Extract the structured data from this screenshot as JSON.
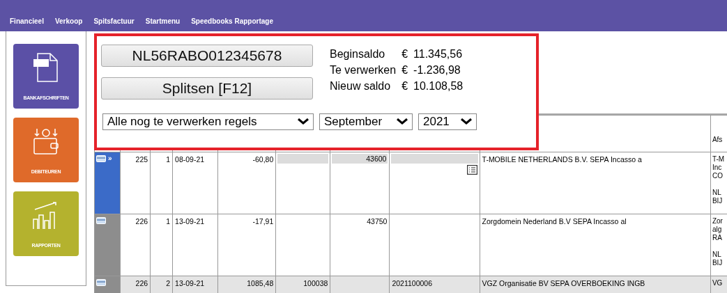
{
  "menu": [
    {
      "label": "Financieel"
    },
    {
      "label": "Verkoop"
    },
    {
      "label": "Spitsfactuur"
    },
    {
      "label": "Startmenu"
    },
    {
      "label": "Speedbooks Rapportage"
    }
  ],
  "tiles": [
    {
      "label": "BANKAFSCHRIFTEN",
      "kind": "bank",
      "color": "#5b50a6"
    },
    {
      "label": "DEBITEUREN",
      "kind": "wallet",
      "color": "#df6a2a"
    },
    {
      "label": "RAPPORTEN",
      "kind": "chart",
      "color": "#b4b22e"
    }
  ],
  "panel": {
    "account": "NL56RABO012345678",
    "split_button": "Splitsen [F12]",
    "balances": [
      {
        "label": "Beginsaldo",
        "currency": "€",
        "amount": "11.345,56"
      },
      {
        "label": "Te verwerken",
        "currency": "€",
        "amount": "-1.236,98"
      },
      {
        "label": "Nieuw saldo",
        "currency": "€",
        "amount": "10.108,58"
      }
    ],
    "filters": [
      {
        "value": "Alle nog te verwerken regels"
      },
      {
        "value": "September"
      },
      {
        "value": "2021"
      }
    ]
  },
  "table": {
    "column_10_header": "Afs",
    "rows": [
      {
        "selected": true,
        "shaded": false,
        "editable": true,
        "marker": "»",
        "nr": "225",
        "rg": "1",
        "date": "08-09-21",
        "amount": "-60,80",
        "debtor": "",
        "ledger": "43600",
        "invoice": "",
        "description": "T-MOBILE NETHERLANDS B.V. SEPA Incasso a",
        "column_10": [
          [
            "T-M",
            "Inc",
            "CO"
          ],
          [
            "NL",
            "BIJ"
          ]
        ]
      },
      {
        "selected": false,
        "shaded": false,
        "editable": false,
        "nr": "226",
        "rg": "1",
        "date": "13-09-21",
        "amount": "-17,91",
        "debtor": "",
        "ledger": "43750",
        "invoice": "",
        "description": "Zorgdomein Nederland B.V SEPA Incasso al",
        "column_10": [
          [
            "Zor",
            "alg",
            "RA"
          ],
          [
            "NL",
            "BIJ"
          ]
        ]
      },
      {
        "selected": false,
        "shaded": true,
        "editable": false,
        "nr": "226",
        "rg": "2",
        "date": "13-09-21",
        "amount": "1085,48",
        "debtor": "100038",
        "ledger": "",
        "invoice": "2021100006",
        "description": "VGZ Organisatie BV SEPA OVERBOEKING INGB",
        "column_10": [
          [
            "VG"
          ]
        ]
      }
    ]
  }
}
